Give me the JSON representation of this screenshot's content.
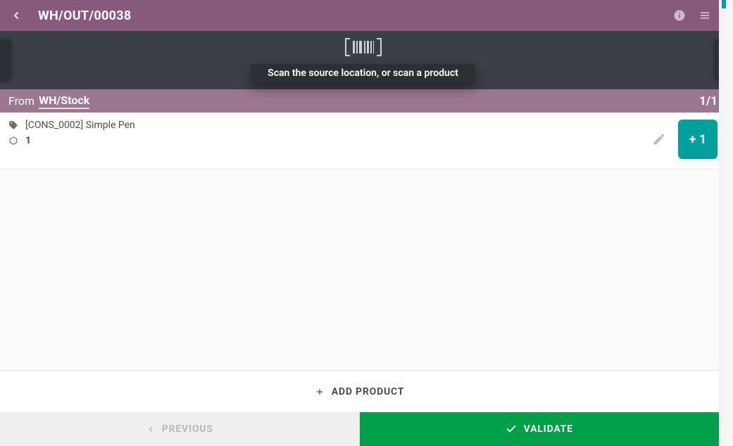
{
  "header": {
    "title": "WH/OUT/00038"
  },
  "scan": {
    "hint": "Scan the source location, or scan a product"
  },
  "from": {
    "label": "From",
    "location": "WH/Stock",
    "counter": "1/1"
  },
  "lines": [
    {
      "name": "[CONS_0002] Simple Pen",
      "qty": "1",
      "increment_label": "+ 1"
    }
  ],
  "footer": {
    "add_product": "ADD PRODUCT",
    "previous": "PREVIOUS",
    "validate": "VALIDATE"
  },
  "colors": {
    "brand": "#875a7b",
    "brand_light": "#9c7791",
    "teal": "#00a09d",
    "green": "#00a04a"
  }
}
